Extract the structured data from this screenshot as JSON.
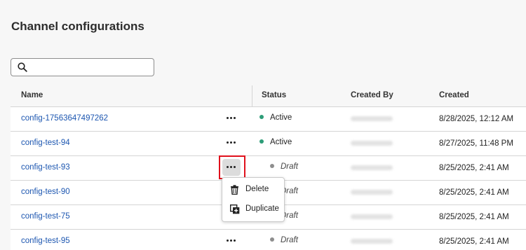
{
  "page": {
    "title": "Channel configurations"
  },
  "search": {
    "placeholder": "",
    "value": ""
  },
  "table": {
    "columns": [
      "Name",
      "Status",
      "Created By",
      "Created"
    ],
    "rows": [
      {
        "name": "config-17563647497262",
        "status": "Active",
        "created": "8/28/2025, 12:12 AM"
      },
      {
        "name": "config-test-94",
        "status": "Active",
        "created": "8/27/2025, 11:48 PM"
      },
      {
        "name": "config-test-93",
        "status": "Draft",
        "created": "8/25/2025, 2:41 AM"
      },
      {
        "name": "config-test-90",
        "status": "Draft",
        "created": "8/25/2025, 2:41 AM"
      },
      {
        "name": "config-test-75",
        "status": "Draft",
        "created": "8/25/2025, 2:41 AM"
      },
      {
        "name": "config-test-95",
        "status": "Draft",
        "created": "8/25/2025, 2:41 AM"
      }
    ]
  },
  "menu": {
    "items": [
      {
        "label": "Delete",
        "icon": "trash-icon"
      },
      {
        "label": "Duplicate",
        "icon": "duplicate-icon"
      }
    ]
  },
  "colors": {
    "active": "#2d9d78",
    "draft": "#8e8e8e",
    "link": "#1c56b0",
    "highlight": "#e0101c"
  }
}
